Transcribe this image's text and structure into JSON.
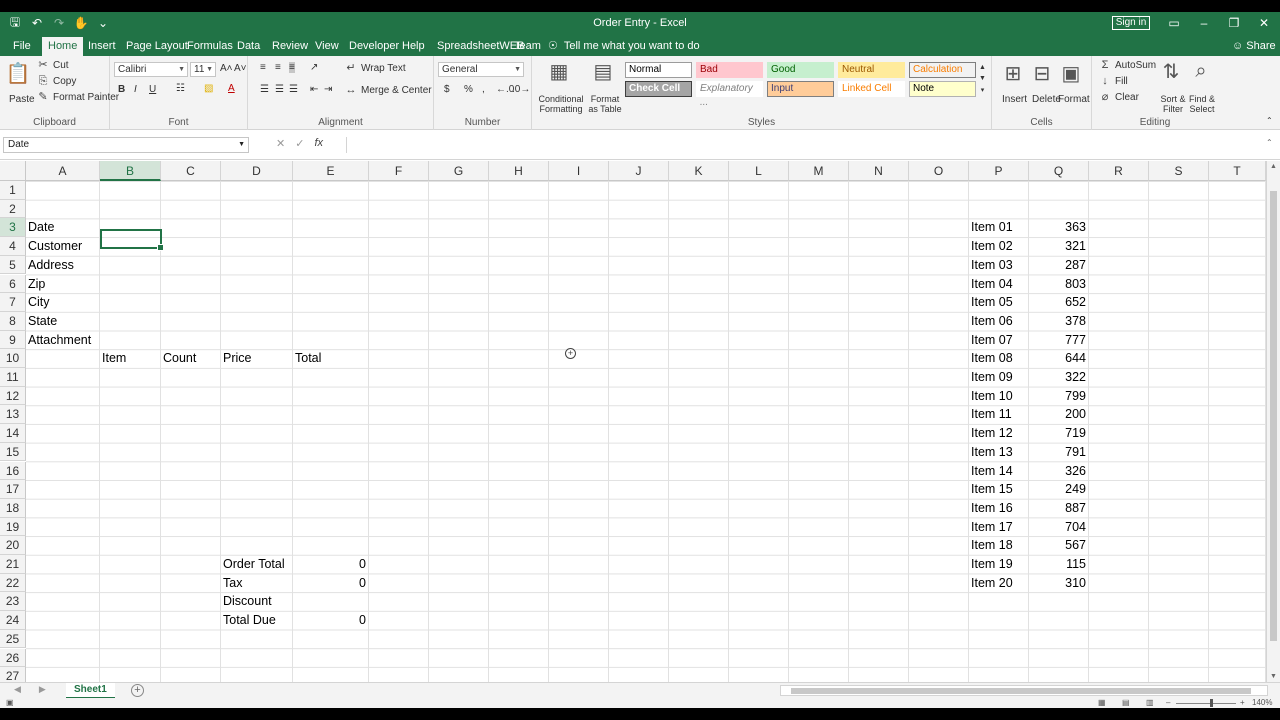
{
  "window": {
    "title": "Order Entry  -  Excel",
    "sign_in": "Sign in"
  },
  "menu": {
    "tabs": [
      "File",
      "Home",
      "Insert",
      "Page Layout",
      "Formulas",
      "Data",
      "Review",
      "View",
      "Developer",
      "Help",
      "SpreadsheetWEB",
      "Team"
    ],
    "active_tab": "Home",
    "tell_me": "Tell me what you want to do",
    "share": "Share"
  },
  "ribbon": {
    "clipboard": {
      "label": "Clipboard",
      "paste": "Paste",
      "cut": "Cut",
      "copy": "Copy",
      "format_painter": "Format Painter"
    },
    "font": {
      "label": "Font",
      "name": "Calibri",
      "size": "11",
      "bold": "B",
      "italic": "I",
      "underline": "U"
    },
    "alignment": {
      "label": "Alignment",
      "wrap": "Wrap Text",
      "merge": "Merge & Center"
    },
    "number": {
      "label": "Number",
      "format": "General",
      "currency": "$",
      "percent": "%",
      "comma": ","
    },
    "styles": {
      "label": "Styles",
      "conditional": "Conditional Formatting",
      "format_table": "Format as Table",
      "cells": [
        {
          "name": "Normal",
          "bg": "#ffffff",
          "fg": "#000000",
          "border": "#9c9c9c"
        },
        {
          "name": "Bad",
          "bg": "#ffc7ce",
          "fg": "#9c0006",
          "border": "#ffc7ce"
        },
        {
          "name": "Good",
          "bg": "#c6efce",
          "fg": "#006100",
          "border": "#c6efce"
        },
        {
          "name": "Neutral",
          "bg": "#ffeb9c",
          "fg": "#9c5700",
          "border": "#ffeb9c"
        },
        {
          "name": "Calculation",
          "bg": "#f2f2f2",
          "fg": "#fa7d00",
          "border": "#7f7f7f"
        },
        {
          "name": "Check Cell",
          "bg": "#a5a5a5",
          "fg": "#ffffff",
          "border": "#3f3f3f"
        },
        {
          "name": "Explanatory ...",
          "bg": "#ffffff",
          "fg": "#7f7f7f",
          "border": "#ffffff"
        },
        {
          "name": "Input",
          "bg": "#ffcc99",
          "fg": "#3f3f76",
          "border": "#7f7f7f"
        },
        {
          "name": "Linked Cell",
          "bg": "#ffffff",
          "fg": "#fa7d00",
          "border": "#ffffff"
        },
        {
          "name": "Note",
          "bg": "#ffffcc",
          "fg": "#000000",
          "border": "#b2b2b2"
        }
      ]
    },
    "cells": {
      "label": "Cells",
      "insert": "Insert",
      "delete": "Delete",
      "format": "Format"
    },
    "editing": {
      "label": "Editing",
      "autosum": "AutoSum",
      "fill": "Fill",
      "clear": "Clear",
      "sort": "Sort & Filter",
      "find": "Find & Select"
    }
  },
  "formula_bar": {
    "name_box": "Date",
    "fx": "fx",
    "formula": ""
  },
  "sheet": {
    "columns": [
      "A",
      "B",
      "C",
      "D",
      "E",
      "F",
      "G",
      "H",
      "I",
      "J",
      "K",
      "L",
      "M",
      "N",
      "O",
      "P",
      "Q",
      "R",
      "S",
      "T"
    ],
    "selected_column": "B",
    "selected_row": "3",
    "rows": [
      "1",
      "2",
      "3",
      "4",
      "5",
      "6",
      "7",
      "8",
      "9",
      "10",
      "11",
      "12",
      "13",
      "14",
      "15",
      "16",
      "17",
      "18",
      "19",
      "20",
      "21",
      "22",
      "23",
      "24",
      "25",
      "26",
      "27"
    ],
    "labels_a": [
      "Date",
      "Customer",
      "Address",
      "Zip",
      "City",
      "State",
      "Attachment"
    ],
    "order_headers": [
      "Item",
      "Count",
      "Price",
      "Total"
    ],
    "summary": [
      {
        "label": "Order Total",
        "value": "0"
      },
      {
        "label": "Tax",
        "value": "0"
      },
      {
        "label": "Discount",
        "value": ""
      },
      {
        "label": "Total Due",
        "value": "0"
      }
    ],
    "items": [
      {
        "name": "Item 01",
        "value": "363"
      },
      {
        "name": "Item 02",
        "value": "321"
      },
      {
        "name": "Item 03",
        "value": "287"
      },
      {
        "name": "Item 04",
        "value": "803"
      },
      {
        "name": "Item 05",
        "value": "652"
      },
      {
        "name": "Item 06",
        "value": "378"
      },
      {
        "name": "Item 07",
        "value": "777"
      },
      {
        "name": "Item 08",
        "value": "644"
      },
      {
        "name": "Item 09",
        "value": "322"
      },
      {
        "name": "Item 10",
        "value": "799"
      },
      {
        "name": "Item 11",
        "value": "200"
      },
      {
        "name": "Item 12",
        "value": "719"
      },
      {
        "name": "Item 13",
        "value": "791"
      },
      {
        "name": "Item 14",
        "value": "326"
      },
      {
        "name": "Item 15",
        "value": "249"
      },
      {
        "name": "Item 16",
        "value": "887"
      },
      {
        "name": "Item 17",
        "value": "704"
      },
      {
        "name": "Item 18",
        "value": "567"
      },
      {
        "name": "Item 19",
        "value": "115"
      },
      {
        "name": "Item 20",
        "value": "310"
      }
    ]
  },
  "sheet_tabs": {
    "active": "Sheet1"
  },
  "status": {
    "zoom": "140%"
  }
}
